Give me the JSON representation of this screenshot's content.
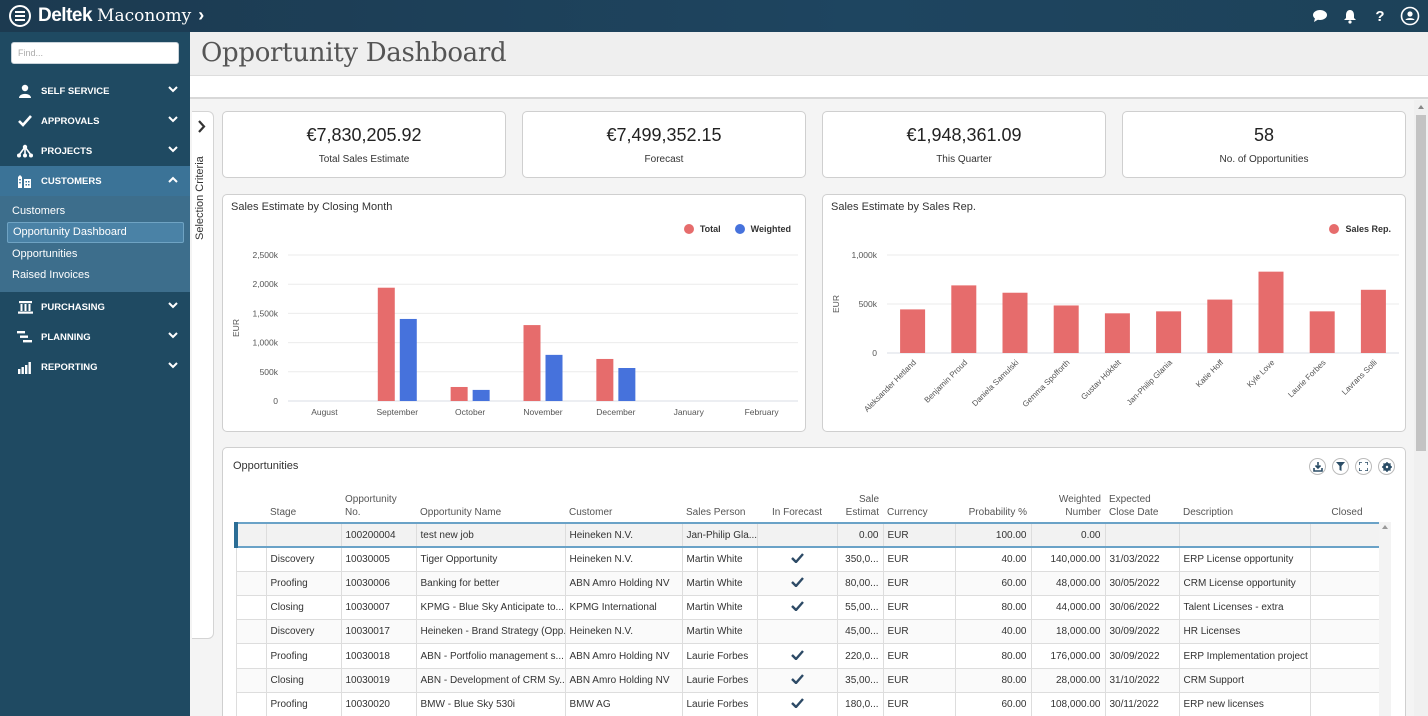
{
  "app": {
    "brand_primary": "Deltek",
    "brand_secondary": "Maconomy",
    "brand_chevron": "›",
    "icons": [
      "chat-icon",
      "bell-icon",
      "help-icon",
      "user-avatar-icon"
    ],
    "help_glyph": "?"
  },
  "sidebar": {
    "search_placeholder": "Find...",
    "items": [
      {
        "label": "SELF SERVICE",
        "icon": "person-icon",
        "expanded": false
      },
      {
        "label": "APPROVALS",
        "icon": "checkmark-icon",
        "expanded": false
      },
      {
        "label": "PROJECTS",
        "icon": "hierarchy-icon",
        "expanded": false
      },
      {
        "label": "CUSTOMERS",
        "icon": "buildings-icon",
        "expanded": true
      },
      {
        "label": "PURCHASING",
        "icon": "bank-icon",
        "expanded": false
      },
      {
        "label": "PLANNING",
        "icon": "gantt-icon",
        "expanded": false
      },
      {
        "label": "REPORTING",
        "icon": "bar-chart-icon",
        "expanded": false
      }
    ],
    "customers_sub": [
      {
        "label": "Customers"
      },
      {
        "label": "Opportunity Dashboard",
        "current": true
      },
      {
        "label": "Opportunities"
      },
      {
        "label": "Raised Invoices"
      }
    ]
  },
  "page": {
    "title": "Opportunity Dashboard",
    "selection_criteria_label": "Selection Criteria"
  },
  "kpis": [
    {
      "value": "€7,830,205.92",
      "label": "Total Sales Estimate"
    },
    {
      "value": "€7,499,352.15",
      "label": "Forecast"
    },
    {
      "value": "€1,948,361.09",
      "label": "This Quarter"
    },
    {
      "value": "58",
      "label": "No. of Opportunities"
    }
  ],
  "colors": {
    "total": "#e66c6c",
    "weighted": "#4672dc",
    "nav_bg": "#1f4a62",
    "nav_active": "#3b7397"
  },
  "chart_data": [
    {
      "type": "bar",
      "title": "Sales Estimate by Closing Month",
      "xlabel": "",
      "ylabel": "EUR",
      "categories": [
        "August",
        "September",
        "October",
        "November",
        "December",
        "January",
        "February"
      ],
      "series": [
        {
          "name": "Total",
          "values": [
            0,
            1940,
            240,
            1300,
            720,
            0,
            0
          ]
        },
        {
          "name": "Weighted",
          "values": [
            0,
            1405,
            190,
            790,
            565,
            0,
            0
          ]
        }
      ],
      "unit": "k EUR",
      "ylim": [
        0,
        2500
      ],
      "yticks": [
        0,
        500,
        1000,
        1500,
        2000,
        2500
      ],
      "ytick_labels": [
        "0",
        "500k",
        "1,000k",
        "1,500k",
        "2,000k",
        "2,500k"
      ],
      "grid": true,
      "legend": "top-right"
    },
    {
      "type": "bar",
      "title": "Sales Estimate by Sales Rep.",
      "xlabel": "",
      "ylabel": "EUR",
      "categories": [
        "Aleksander Hetland",
        "Benjamin Proud",
        "Daniela Samulski",
        "Gemma Spofforth",
        "Gustav Hökfelt",
        "Jan-Philip Glania",
        "Katie Hoff",
        "Kyle Love",
        "Laurie Forbes",
        "Lavrans Solli"
      ],
      "series": [
        {
          "name": "Sales Rep.",
          "values": [
            445,
            690,
            615,
            485,
            405,
            425,
            545,
            830,
            425,
            645
          ]
        }
      ],
      "unit": "k EUR",
      "ylim": [
        0,
        1000
      ],
      "yticks": [
        0,
        500,
        1000
      ],
      "ytick_labels": [
        "0",
        "500k",
        "1,000k"
      ],
      "grid": true,
      "legend": "top-right"
    }
  ],
  "opportunities": {
    "title": "Opportunities",
    "tools": [
      "export-icon",
      "filter-icon",
      "fullscreen-icon",
      "settings-icon"
    ],
    "columns": [
      "Stage",
      "Opportunity No.",
      "Opportunity Name",
      "Customer",
      "Sales Person",
      "In Forecast",
      "Sale Estimat",
      "Currency",
      "Probability %",
      "Weighted Number",
      "Expected Close Date",
      "Description",
      "Closed"
    ],
    "column_lines": [
      [
        "",
        "Stage"
      ],
      [
        "Opportunity",
        "No."
      ],
      [
        "",
        "Opportunity Name"
      ],
      [
        "",
        "Customer"
      ],
      [
        "",
        "Sales Person"
      ],
      [
        "",
        "In Forecast"
      ],
      [
        "Sale",
        "Estimat"
      ],
      [
        "",
        "Currency"
      ],
      [
        "",
        "Probability %"
      ],
      [
        "Weighted",
        "Number"
      ],
      [
        "Expected",
        "Close Date"
      ],
      [
        "",
        "Description"
      ],
      [
        "",
        "Closed"
      ]
    ],
    "rows": [
      {
        "stage": "",
        "no": "100200004",
        "name": "test new job",
        "customer": "Heineken N.V.",
        "person": "Jan-Philip Gla...",
        "forecast": false,
        "estimate": "0.00",
        "currency": "EUR",
        "prob": "100.00",
        "weighted": "0.00",
        "close": "",
        "desc": "",
        "closed": ""
      },
      {
        "stage": "Discovery",
        "no": "10030005",
        "name": "Tiger Opportunity",
        "customer": "Heineken N.V.",
        "person": "Martin White",
        "forecast": true,
        "estimate": "350,0...",
        "currency": "EUR",
        "prob": "40.00",
        "weighted": "140,000.00",
        "close": "31/03/2022",
        "desc": "ERP License opportunity",
        "closed": ""
      },
      {
        "stage": "Proofing",
        "no": "10030006",
        "name": "Banking for better",
        "customer": "ABN Amro Holding NV",
        "person": "Martin White",
        "forecast": true,
        "estimate": "80,00...",
        "currency": "EUR",
        "prob": "60.00",
        "weighted": "48,000.00",
        "close": "30/05/2022",
        "desc": "CRM License opportunity",
        "closed": ""
      },
      {
        "stage": "Closing",
        "no": "10030007",
        "name": "KPMG - Blue Sky Anticipate to...",
        "customer": "KPMG International",
        "person": "Martin White",
        "forecast": true,
        "estimate": "55,00...",
        "currency": "EUR",
        "prob": "80.00",
        "weighted": "44,000.00",
        "close": "30/06/2022",
        "desc": "Talent Licenses - extra",
        "closed": ""
      },
      {
        "stage": "Discovery",
        "no": "10030017",
        "name": "Heineken - Brand Strategy (Opp.)",
        "customer": "Heineken N.V.",
        "person": "Martin White",
        "forecast": false,
        "estimate": "45,00...",
        "currency": "EUR",
        "prob": "40.00",
        "weighted": "18,000.00",
        "close": "30/09/2022",
        "desc": "HR Licenses",
        "closed": ""
      },
      {
        "stage": "Proofing",
        "no": "10030018",
        "name": "ABN - Portfolio management s...",
        "customer": "ABN Amro Holding NV",
        "person": "Laurie Forbes",
        "forecast": true,
        "estimate": "220,0...",
        "currency": "EUR",
        "prob": "80.00",
        "weighted": "176,000.00",
        "close": "30/09/2022",
        "desc": "ERP Implementation project",
        "closed": ""
      },
      {
        "stage": "Closing",
        "no": "10030019",
        "name": "ABN - Development of CRM Sy...",
        "customer": "ABN Amro Holding NV",
        "person": "Laurie Forbes",
        "forecast": true,
        "estimate": "35,00...",
        "currency": "EUR",
        "prob": "80.00",
        "weighted": "28,000.00",
        "close": "31/10/2022",
        "desc": "CRM Support",
        "closed": ""
      },
      {
        "stage": "Proofing",
        "no": "10030020",
        "name": "BMW - Blue Sky 530i",
        "customer": "BMW AG",
        "person": "Laurie Forbes",
        "forecast": true,
        "estimate": "180,0...",
        "currency": "EUR",
        "prob": "60.00",
        "weighted": "108,000.00",
        "close": "30/11/2022",
        "desc": "ERP new licenses",
        "closed": ""
      }
    ]
  }
}
